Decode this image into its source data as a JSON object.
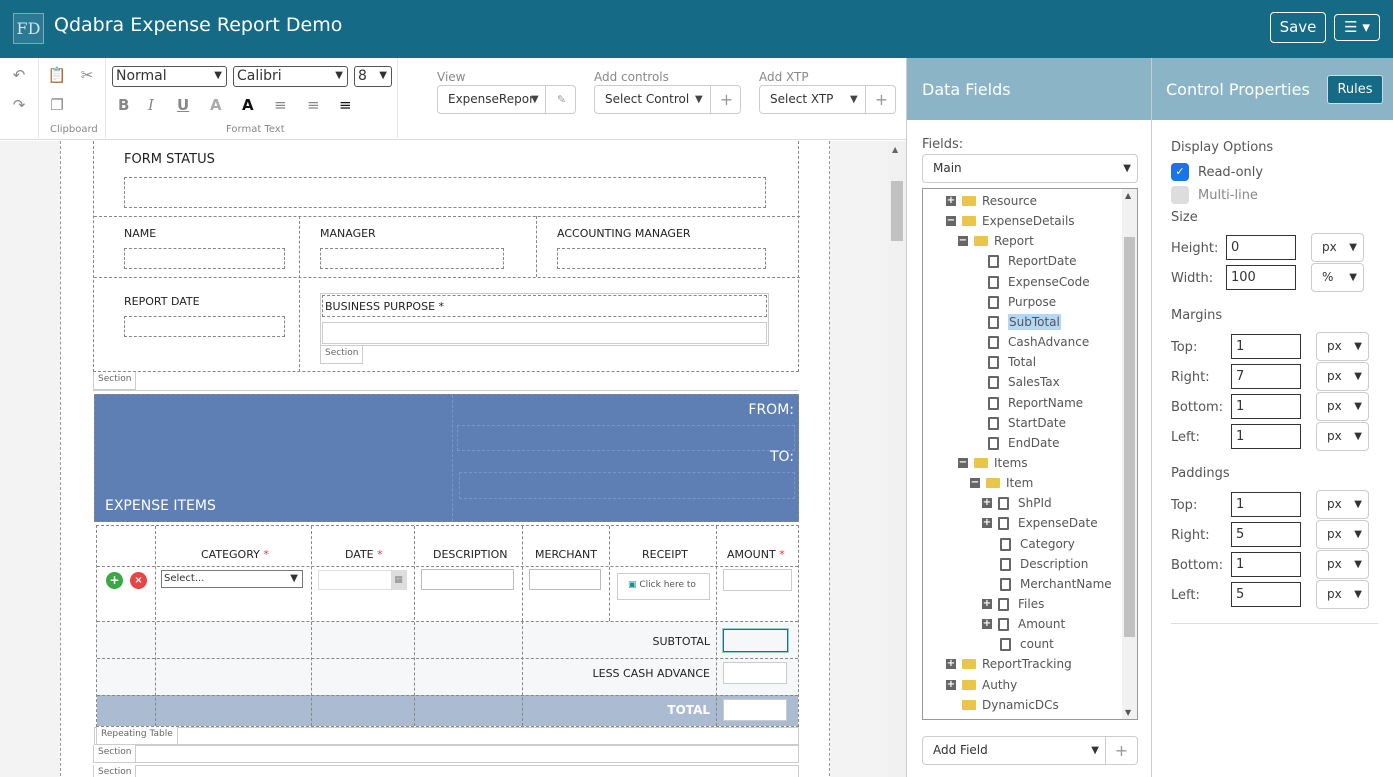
{
  "header": {
    "title": "Qdabra Expense Report Demo",
    "logo_text": "FD",
    "save_label": "Save",
    "menu_icon": "hamburger-icon"
  },
  "toolbar": {
    "style": "Normal",
    "font": "Calibri",
    "size": "8",
    "clipboard_label": "Clipboard",
    "format_text_label": "Format Text",
    "view_label": "View",
    "view_value": "ExpenseRepor",
    "add_controls_label": "Add controls",
    "add_controls_value": "Select Control",
    "add_xtp_label": "Add XTP",
    "add_xtp_value": "Select XTP"
  },
  "form": {
    "form_status": "FORM STATUS",
    "name": "NAME",
    "manager": "MANAGER",
    "accounting_manager": "ACCOUNTING MANAGER",
    "report_date": "REPORT DATE",
    "business_purpose": "BUSINESS PURPOSE *",
    "section": "Section",
    "from": "FROM:",
    "to": "TO:",
    "expense_items": "EXPENSE ITEMS",
    "columns": [
      "CATEGORY",
      "DATE",
      "DESCRIPTION",
      "MERCHANT",
      "RECEIPT",
      "AMOUNT"
    ],
    "required_mark": "*",
    "category_placeholder": "Select...",
    "receipt_text": "Click here to",
    "subtotal": "SUBTOTAL",
    "less_cash_advance": "LESS CASH ADVANCE",
    "total": "TOTAL",
    "repeating_table": "Repeating Table",
    "header_band_color": "#5d7fb4",
    "total_row_color": "#aabbd2"
  },
  "data_fields": {
    "title": "Data Fields",
    "fields_label": "Fields:",
    "source": "Main",
    "add_field": "Add Field",
    "tree": [
      {
        "label": "Resource",
        "level": 0,
        "type": "folder",
        "expander": "plus"
      },
      {
        "label": "ExpenseDetails",
        "level": 0,
        "type": "folder",
        "expander": "minus"
      },
      {
        "label": "Report",
        "level": 1,
        "type": "folder",
        "expander": "minus"
      },
      {
        "label": "ReportDate",
        "level": 2,
        "type": "field"
      },
      {
        "label": "ExpenseCode",
        "level": 2,
        "type": "field"
      },
      {
        "label": "Purpose",
        "level": 2,
        "type": "field"
      },
      {
        "label": "SubTotal",
        "level": 2,
        "type": "field",
        "selected": true
      },
      {
        "label": "CashAdvance",
        "level": 2,
        "type": "field"
      },
      {
        "label": "Total",
        "level": 2,
        "type": "field"
      },
      {
        "label": "SalesTax",
        "level": 2,
        "type": "field"
      },
      {
        "label": "ReportName",
        "level": 2,
        "type": "field"
      },
      {
        "label": "StartDate",
        "level": 2,
        "type": "field"
      },
      {
        "label": "EndDate",
        "level": 2,
        "type": "field"
      },
      {
        "label": "Items",
        "level": 1,
        "type": "folder",
        "expander": "minus"
      },
      {
        "label": "Item",
        "level": 2,
        "type": "folder",
        "expander": "minus",
        "repeating": true
      },
      {
        "label": "ShPId",
        "level": 3,
        "type": "field",
        "expander": "plus"
      },
      {
        "label": "ExpenseDate",
        "level": 3,
        "type": "field",
        "expander": "plus"
      },
      {
        "label": "Category",
        "level": 3,
        "type": "field"
      },
      {
        "label": "Description",
        "level": 3,
        "type": "field"
      },
      {
        "label": "MerchantName",
        "level": 3,
        "type": "field"
      },
      {
        "label": "Files",
        "level": 3,
        "type": "field",
        "expander": "plus"
      },
      {
        "label": "Amount",
        "level": 3,
        "type": "field",
        "expander": "plus"
      },
      {
        "label": "count",
        "level": 3,
        "type": "field"
      },
      {
        "label": "ReportTracking",
        "level": 0,
        "type": "folder",
        "expander": "plus"
      },
      {
        "label": "Authy",
        "level": 0,
        "type": "folder",
        "expander": "plus"
      },
      {
        "label": "DynamicDCs",
        "level": 0,
        "type": "folder"
      }
    ]
  },
  "control_properties": {
    "title": "Control Properties",
    "rules_label": "Rules",
    "display_options": "Display Options",
    "read_only": "Read-only",
    "read_only_checked": true,
    "multi_line": "Multi-line",
    "multi_line_checked": false,
    "size": "Size",
    "height_label": "Height:",
    "height": "0",
    "height_unit": "px",
    "width_label": "Width:",
    "width": "100",
    "width_unit": "%",
    "margins": "Margins",
    "margin_rows": [
      {
        "label": "Top:",
        "value": "1",
        "unit": "px"
      },
      {
        "label": "Right:",
        "value": "7",
        "unit": "px"
      },
      {
        "label": "Bottom:",
        "value": "1",
        "unit": "px"
      },
      {
        "label": "Left:",
        "value": "1",
        "unit": "px"
      }
    ],
    "paddings": "Paddings",
    "padding_rows": [
      {
        "label": "Top:",
        "value": "1",
        "unit": "px"
      },
      {
        "label": "Right:",
        "value": "5",
        "unit": "px"
      },
      {
        "label": "Bottom:",
        "value": "1",
        "unit": "px"
      },
      {
        "label": "Left:",
        "value": "5",
        "unit": "px"
      }
    ],
    "accent_color": "#1a73e8"
  }
}
